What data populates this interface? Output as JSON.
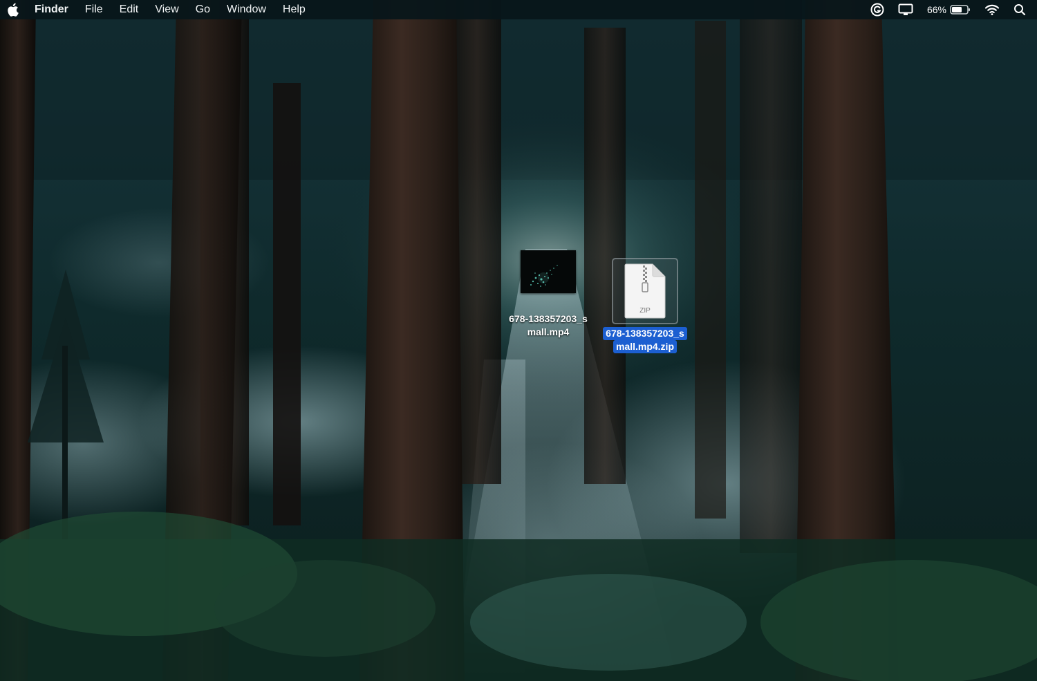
{
  "menubar": {
    "app_name": "Finder",
    "menus": [
      "File",
      "Edit",
      "View",
      "Go",
      "Window",
      "Help"
    ],
    "status": {
      "battery_percent": "66%",
      "icons": [
        "grammarly-icon",
        "display-icon",
        "battery-icon",
        "wifi-icon",
        "spotlight-search-icon"
      ]
    }
  },
  "desktop": {
    "wallpaper": "misty redwood forest",
    "files": [
      {
        "name_line1": "678-138357203_s",
        "name_line2": "mall.mp4",
        "type": "video",
        "selected": false
      },
      {
        "name_line1": "678-138357203_s",
        "name_line2": "mall.mp4.zip",
        "type": "zip",
        "icon_text": "ZIP",
        "selected": true
      }
    ]
  },
  "colors": {
    "selection": "#1c5fd1",
    "menubar": "#08161a"
  }
}
